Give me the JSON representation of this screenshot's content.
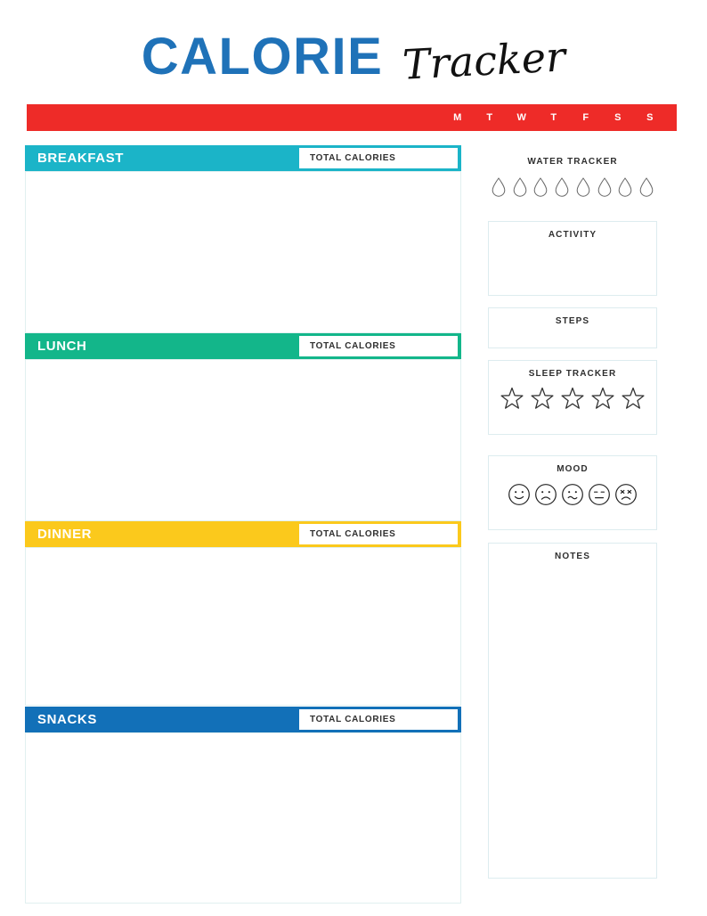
{
  "header": {
    "title_main": "CALORIE",
    "title_script": "Tracker"
  },
  "day_bar": {
    "color": "#ee2b28",
    "days": [
      "M",
      "T",
      "W",
      "T",
      "F",
      "S",
      "S"
    ]
  },
  "meals": [
    {
      "name": "BREAKFAST",
      "color": "#1bb4c8",
      "total_label": "TOTAL CALORIES",
      "value": ""
    },
    {
      "name": "LUNCH",
      "color": "#13b68a",
      "total_label": "TOTAL CALORIES",
      "value": ""
    },
    {
      "name": "DINNER",
      "color": "#fbc91c",
      "total_label": "TOTAL CALORIES",
      "value": ""
    },
    {
      "name": "SNACKS",
      "color": "#1270b8",
      "total_label": "TOTAL CALORIES",
      "value": ""
    }
  ],
  "sidebar": {
    "water": {
      "label": "WATER TRACKER",
      "drop_count": 8,
      "icon": "water-drop-icon"
    },
    "activity": {
      "label": "ACTIVITY",
      "value": ""
    },
    "steps": {
      "label": "STEPS",
      "value": ""
    },
    "sleep": {
      "label": "SLEEP TRACKER",
      "star_count": 5,
      "icon": "star-icon"
    },
    "mood": {
      "label": "MOOD",
      "faces": [
        "happy-face-icon",
        "sad-face-icon",
        "confused-face-icon",
        "neutral-face-icon",
        "angry-face-icon"
      ]
    },
    "notes": {
      "label": "NOTES",
      "value": ""
    }
  },
  "colors": {
    "brand_blue": "#1f72b8",
    "red": "#ee2b28",
    "teal": "#1bb4c8",
    "green": "#13b68a",
    "yellow": "#fbc91c",
    "blue": "#1270b8",
    "panel_border": "#ddecef",
    "meal_border": "#e1f0f0",
    "outline": "#555555"
  }
}
